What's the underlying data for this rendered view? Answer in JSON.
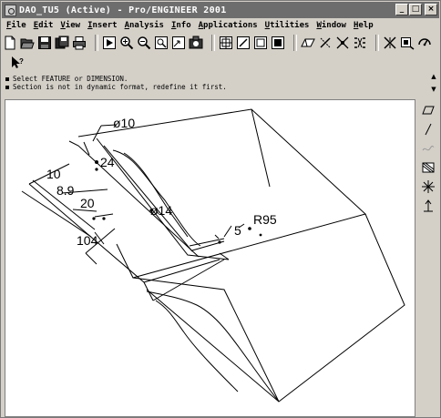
{
  "window": {
    "title": "DAO_TU5 (Active) - Pro/ENGINEER 2001",
    "minimize_glyph": "_",
    "maximize_glyph": "□",
    "close_glyph": "×"
  },
  "menu": {
    "items": [
      "File",
      "Edit",
      "View",
      "Insert",
      "Analysis",
      "Info",
      "Applications",
      "Utilities",
      "Window",
      "Help"
    ]
  },
  "toolbar": {
    "row1": [
      "new-file-icon",
      "open-file-icon",
      "save-icon",
      "save-copy-icon",
      "print-icon",
      "repaint-icon",
      "zoom-in-icon",
      "zoom-out-icon",
      "refit-icon",
      "orient-icon",
      "saved-views-icon",
      "datum-planes-icon",
      "datum-axes-icon",
      "datum-points-icon",
      "coordinate-systems-icon",
      "wireframe-icon",
      "hidden-line-icon",
      "no-hidden-icon",
      "shading-icon",
      "model-tree-icon",
      "layers-icon",
      "help-pointer-icon"
    ],
    "row2": [
      "context-help-icon"
    ]
  },
  "messages": {
    "line1": "Select FEATURE or DIMENSION.",
    "line2": "Section is not in dynamic format, redefine it first."
  },
  "graphics": {
    "dimensions": [
      {
        "id": "phi10",
        "text": "ø10"
      },
      {
        "id": "d10",
        "text": "10"
      },
      {
        "id": "d24",
        "text": "24"
      },
      {
        "id": "d89",
        "text": "8.9"
      },
      {
        "id": "d20",
        "text": "20"
      },
      {
        "id": "phi14",
        "text": "ø14"
      },
      {
        "id": "d104",
        "text": "104"
      },
      {
        "id": "r95",
        "text": "R95"
      },
      {
        "id": "d5",
        "text": "5"
      }
    ]
  },
  "right_toolbar": [
    "sketch-icon",
    "line-icon",
    "spline-icon",
    "trim-icon",
    "dimension-icon",
    "constraint-icon"
  ]
}
